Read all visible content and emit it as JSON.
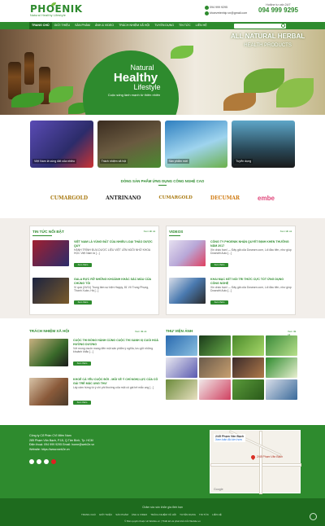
{
  "header": {
    "logo": "PHOENIK",
    "slogan": "Natural Healthy Lifestyle",
    "phone": "094 999 9295",
    "email": "khoevetenhip.vn@gmail.com",
    "hotline_label": "Hotline tư vấn 24/7",
    "hotline": "094 999 9295"
  },
  "nav": {
    "items": [
      "TRANG CHỦ",
      "GIỚI THIỆU",
      "SẢN PHẨM",
      "ẢNH & VIDEO",
      "TRÁCH NHIỆM XÃ HỘI",
      "TUYỂN DỤNG",
      "TIN TỨC",
      "LIÊN HỆ"
    ]
  },
  "banner": {
    "t1": "Natural",
    "t2": "Healthy",
    "t3": "Lifestyle",
    "sub": "Cuộc sống lành mạnh từ thiên nhiên",
    "right1": "ALL NATURAL HERBAL",
    "right2": "HEALTH PRODUCTS"
  },
  "tiles": [
    "Việt Nam là vùng đất của nhiều",
    "Trách nhiệm xã hội",
    "Sản phẩm mới",
    "Tuyển dụng"
  ],
  "tech": {
    "title": "DÒNG SẢN PHẨM ỨNG DỤNG CÔNG NGHỆ CAO",
    "brands": [
      "CUMARGOLD",
      "ANTRINANO",
      "CUMARGOLD",
      "DECUMAR",
      "embe"
    ]
  },
  "news": {
    "title": "TIN TỨC NỔI BẬT",
    "more": "Xem tất cả",
    "posts": [
      {
        "title": "VIỆT NAM LÀ VÙNG ĐẤT CỦA NHIỀU LOẠI THẢO DƯỢC QUÝ",
        "desc": "HÀNH TRÌNH ĐƯA DƯỢC LIỆU VIỆT LÊN NGÔI NHỜ KHOA HỌC   Việt Nam là [...]",
        "btn": "Xem thêm"
      },
      {
        "title": "GALA RỰC RỠ NHỮNG KHOẢNH KHẮC SẮC MÀU CỦA CHÚNG TÔI",
        "desc": "Vì quá (24/11) Trung tâm sự kiện Happy, 81 Võ Trung Phụng, Thanh Xuân, Hà [...]",
        "btn": "Xem thêm"
      }
    ]
  },
  "videos": {
    "title": "VIDEOS",
    "more": "Xem tất cả",
    "posts": [
      {
        "title": "CÔNG TY PHOENIK NHẬN QUYẾT ĐỊNH KHEN THƯỞNG NĂM 2017",
        "desc": "Xin chào bạn! — Đây giả của Dosearn.com, Lối đầu tiên, như giúp Doseafri Auto [...]",
        "btn": "Xem thêm"
      },
      {
        "title": "KHAI MẠC KẾT NỐI TRI THỨC CỰC TỐT ỨNG DỤNG CÔNG NGHỆ",
        "desc": "Xin chào bạn! — Đây giả của Dosearn.com, Lối đầu tiên, như giúp Doseafri Auto [...]",
        "btn": "Xem thêm"
      }
    ]
  },
  "social": {
    "title": "TRÁCH NHIỆM XÃ HỘI",
    "more": "Xem tất cả",
    "posts": [
      {
        "title": "CUỘC THI ĐỒNG HÀNH CÙNG CUỘC THI XANH XỊ CUỐI HOÀ HƯỜNG DƯƠNG",
        "desc": "Với mong muốn mang đến một sản phẩm ý nghĩa, lưu giữ những khoảnh khắc [...]",
        "btn": "Xem thêm"
      },
      {
        "title": "KHOẺ CÀ YÊU CUỘC ĐỜI - MỖI VỀ Ý CHÍ NGHỊ LỰC CỦA CÔ GÁI TRẺ MẮC UNG THƯ",
        "desc": "Lấy cảm hứng từ ý chí phi thường của một cô gái trẻ mắc ung [...]",
        "btn": "Xem thêm"
      }
    ]
  },
  "gallery": {
    "title": "THƯ VIỆN ẢNH",
    "more": "Xem tất cả"
  },
  "footer": {
    "company": "Công ty Cổ Phần CVI Miền Nam",
    "address": "285 Phạm Văn Bạch, P.15, Q.Tân Bình, Tp. HCM",
    "contact": "Điện thoại: 094 999 9295  Email: home@web2e.vn",
    "website": "Website: https://www.web2e.vn",
    "map_title": "2/45 Phạm Văn Bạch",
    "map_link": "Xem bản đồ lớn hơn",
    "map_place": "2/45 Phạm Văn Bạch",
    "map_brand": "Google"
  },
  "bottom": {
    "tagline": "Chăm sóc sức khỏe gia đình bạn",
    "links": [
      "TRANG CHỦ",
      "GIỚI THIỆU",
      "SẢN PHẨM",
      "ẢNH & VIDEO",
      "TRÁCH NHIỆM XÃ HỘI",
      "TUYỂN DỤNG",
      "TIN TỨC",
      "LIÊN HỆ"
    ],
    "copyright": "© Bản quyền thuộc về Web2e.vn | Thiết kế và phát triển bởi Web2e.vn"
  },
  "colors": {
    "brand": "#2e8b2e"
  }
}
